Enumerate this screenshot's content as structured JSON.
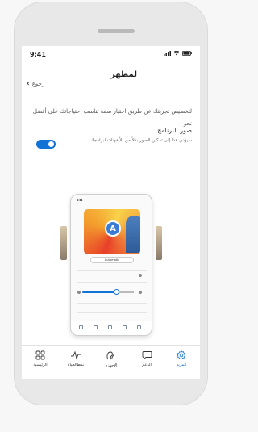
{
  "status_bar": {
    "time": "9:41"
  },
  "header": {
    "title": "لمظهر",
    "back_label": "رجوع"
  },
  "description": "لتخصيص تجربتك عن طريق اختيار سمة تناسب احتياجاتك على أفضل نحو",
  "setting": {
    "title": "صور البرنامج",
    "subtitle": "سيؤدي هذا إلى تمكين الصور بدلاً من الأيقونات لبرامجك",
    "enabled": true
  },
  "preview": {
    "time": "9:41",
    "badge": "A",
    "mode_label": "Automatic"
  },
  "bottom_nav": {
    "items": [
      {
        "label": "الرئيسية",
        "icon": "grid-icon"
      },
      {
        "label": "نمطالحياة",
        "icon": "activity-icon"
      },
      {
        "label": "الأجهزة",
        "icon": "hearing-aid-icon"
      },
      {
        "label": "الدعم",
        "icon": "chat-icon"
      },
      {
        "label": "المزيد",
        "icon": "gear-icon",
        "active": true
      }
    ]
  },
  "colors": {
    "accent": "#1273d6"
  }
}
